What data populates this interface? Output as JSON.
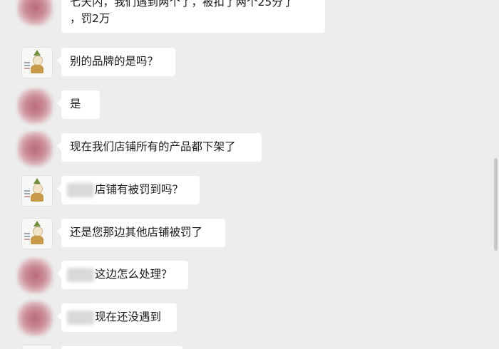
{
  "messages": [
    {
      "sender": "other",
      "lines": [
        "七天内，我们遇到两个了，被扣了两个25分了",
        "，罚2万"
      ]
    },
    {
      "sender": "me",
      "text": "别的品牌的是吗？"
    },
    {
      "sender": "other",
      "text": "是"
    },
    {
      "sender": "other",
      "text": "现在我们店铺所有的产品都下架了"
    },
    {
      "sender": "me",
      "text": "店铺有被罚到吗？"
    },
    {
      "sender": "me",
      "text": "还是您那边其他店铺被罚了"
    },
    {
      "sender": "other",
      "text": "这边怎么处理？"
    },
    {
      "sender": "other",
      "text": "现在还没遇到"
    }
  ]
}
